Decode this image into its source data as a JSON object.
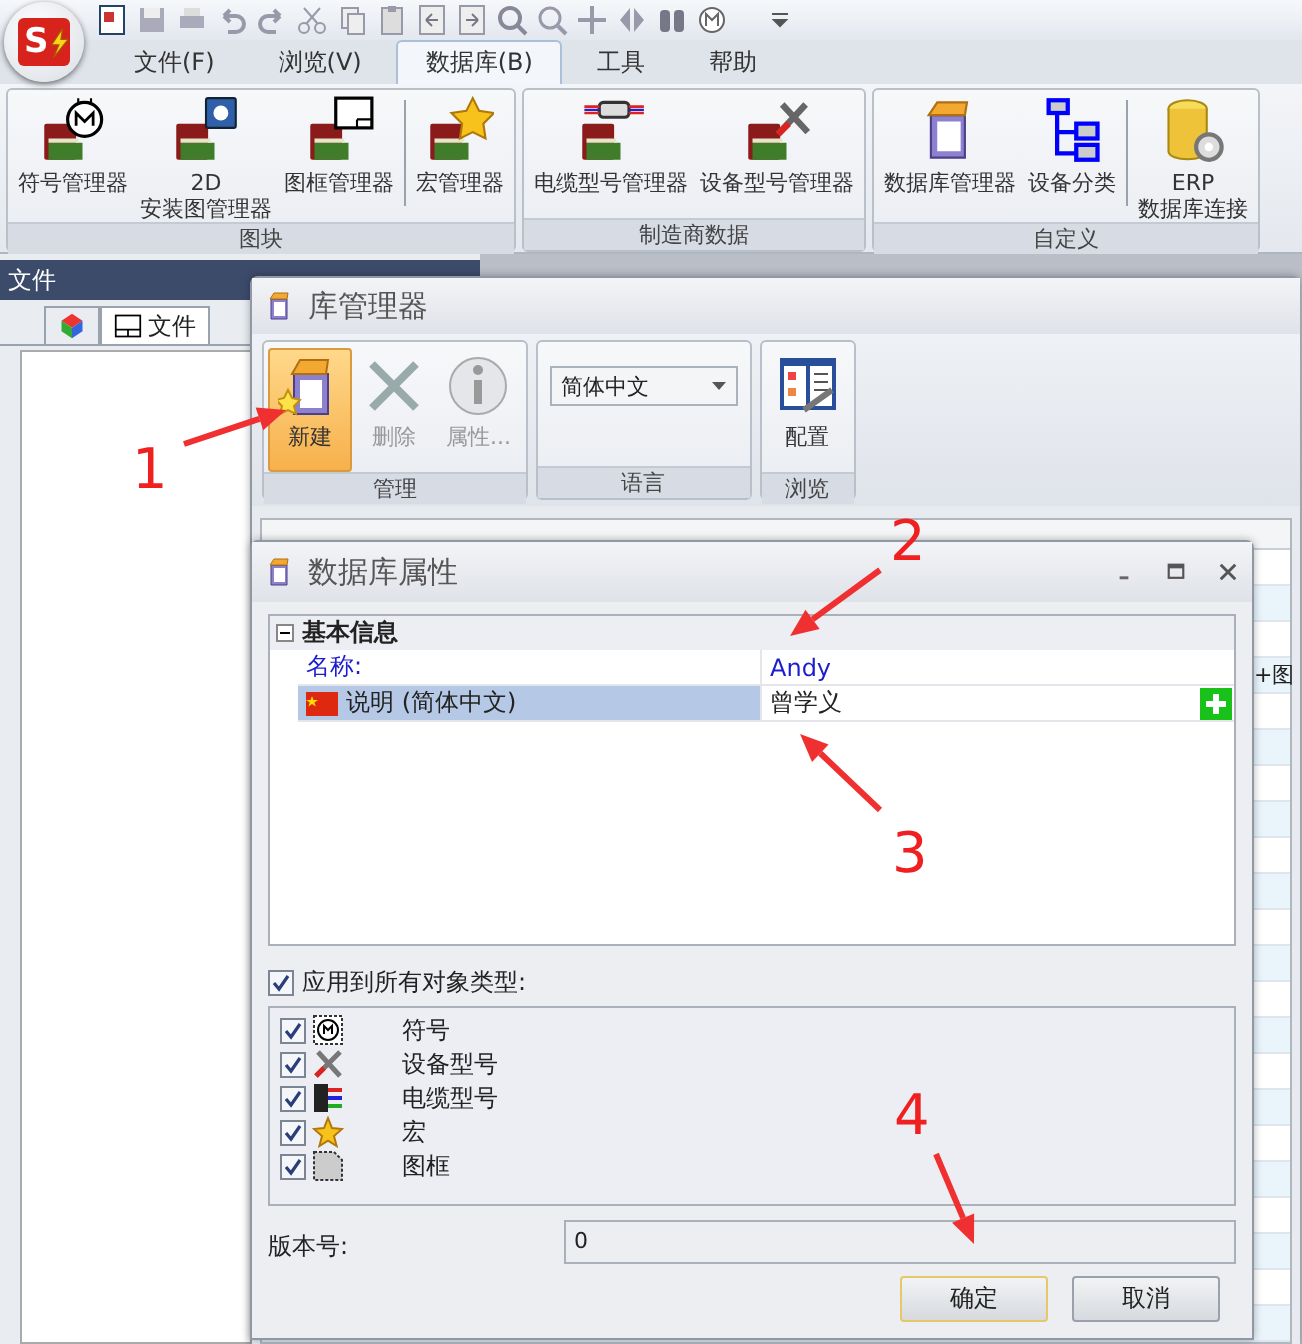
{
  "logo_text": "S",
  "menu_tabs": [
    {
      "label": "文件(F)",
      "selected": false
    },
    {
      "label": "浏览(V)",
      "selected": false
    },
    {
      "label": "数据库(B)",
      "selected": true
    },
    {
      "label": "工具",
      "selected": false
    },
    {
      "label": "帮助",
      "selected": false
    }
  ],
  "ribbon_groups": [
    {
      "label": "图块",
      "buttons": [
        {
          "label": "符号管理器",
          "kind": "symbol",
          "separator_before": false
        },
        {
          "label": "2D\n安装图管理器",
          "kind": "layout",
          "separator_before": false
        },
        {
          "label": "图框管理器",
          "kind": "frame",
          "separator_before": false
        },
        {
          "label": "宏管理器",
          "kind": "macro",
          "separator_before": true
        }
      ]
    },
    {
      "label": "制造商数据",
      "buttons": [
        {
          "label": "电缆型号管理器",
          "kind": "cable",
          "separator_before": false
        },
        {
          "label": "设备型号管理器",
          "kind": "part",
          "separator_before": false
        }
      ]
    },
    {
      "label": "自定义",
      "buttons": [
        {
          "label": "数据库管理器",
          "kind": "box",
          "separator_before": false
        },
        {
          "label": "设备分类",
          "kind": "tree",
          "separator_before": false
        },
        {
          "label": "ERP\n数据库连接",
          "kind": "db",
          "separator_before": true
        }
      ]
    }
  ],
  "left_panel": {
    "title": "文件",
    "tabs": [
      {
        "kind": "icon",
        "selected": false
      },
      {
        "kind": "text",
        "label": "文件",
        "selected": true
      }
    ]
  },
  "library_manager": {
    "title": "库管理器",
    "groups": [
      {
        "label": "管理",
        "kind": "buttons",
        "buttons": [
          {
            "label": "新建",
            "kind": "new",
            "selected": true,
            "disabled": false
          },
          {
            "label": "删除",
            "kind": "delete",
            "selected": false,
            "disabled": true
          },
          {
            "label": "属性...",
            "kind": "info",
            "selected": false,
            "disabled": true
          }
        ]
      },
      {
        "label": "语言",
        "kind": "dropdown",
        "value": "简体中文"
      },
      {
        "label": "浏览",
        "kind": "buttons",
        "buttons": [
          {
            "label": "配置",
            "kind": "config",
            "selected": false,
            "disabled": false
          }
        ]
      }
    ],
    "visible_cell": "+图"
  },
  "properties_dialog": {
    "title": "数据库属性",
    "section": {
      "label": "基本信息",
      "expanded": true,
      "rows": [
        {
          "kind": "required",
          "name": "名称:",
          "value": "Andy",
          "selected": false
        },
        {
          "kind": "translation",
          "name": "说明 (简体中文)",
          "value": "曾学义",
          "selected": true
        }
      ]
    },
    "apply_all": {
      "label": "应用到所有对象类型:",
      "checked": true
    },
    "object_types": [
      {
        "kind": "symbol",
        "label": "符号",
        "checked": true
      },
      {
        "kind": "part",
        "label": "设备型号",
        "checked": true
      },
      {
        "kind": "cable",
        "label": "电缆型号",
        "checked": true
      },
      {
        "kind": "macro",
        "label": "宏",
        "checked": true
      },
      {
        "kind": "frame",
        "label": "图框",
        "checked": true
      }
    ],
    "version": {
      "label": "版本号:",
      "value": "0"
    },
    "buttons": [
      {
        "label": "确定",
        "default": true
      },
      {
        "label": "取消",
        "default": false
      }
    ]
  },
  "annotations": [
    {
      "label": "1"
    },
    {
      "label": "2"
    },
    {
      "label": "3"
    },
    {
      "label": "4"
    }
  ]
}
